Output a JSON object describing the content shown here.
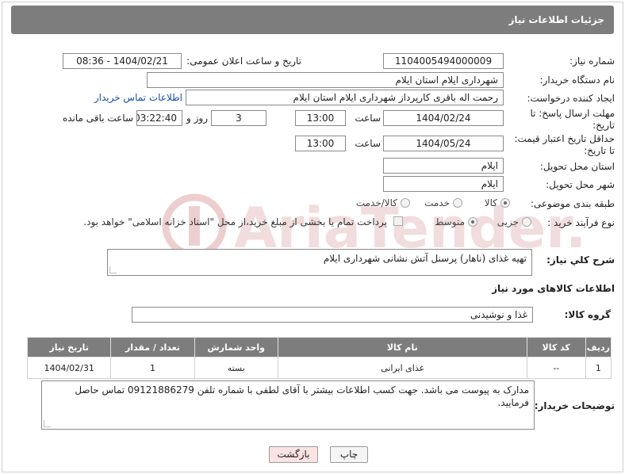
{
  "header": {
    "title": "جزئیات اطلاعات نیاز"
  },
  "form": {
    "need_number_label": "شماره نیاز:",
    "need_number": "1104005494000009",
    "announce_label": "تاریخ و ساعت اعلان عمومی:",
    "announce_value": "1404/02/21 - 08:36",
    "buyer_org_label": "نام دستگاه خریدار:",
    "buyer_org": "شهرداری ایلام استان ایلام",
    "creator_label": "ایجاد کننده درخواست:",
    "creator": "رحمت اله باقری کارپرداز شهرداری ایلام استان ایلام",
    "contact_link": "اطلاعات تماس خریدار",
    "deadline_label_1": "مهلت ارسال پاسخ: تا",
    "deadline_label_2": "تاریخ:",
    "deadline_date": "1404/02/24",
    "time_label": "ساعت",
    "deadline_time": "13:00",
    "days_value": "3",
    "days_label": "روز و",
    "remaining_time": "03:22:40",
    "remaining_label": "ساعت باقی مانده",
    "validity_label_1": "حداقل تاریخ اعتبار قیمت:",
    "validity_label_2": "تا تاریخ:",
    "validity_date": "1404/05/24",
    "validity_time": "13:00",
    "province_label": "استان محل تحویل:",
    "province": "ایلام",
    "city_label": "شهر محل تحویل:",
    "city": "ایلام",
    "category_label": "طبقه بندی موضوعی:",
    "category_options": [
      "کالا",
      "خدمت",
      "کالا/خدمت"
    ],
    "purchase_type_label": "نوع فرآیند خرید :",
    "purchase_options": [
      "جزیی",
      "متوسط"
    ],
    "payment_note": "پرداخت تمام یا بخشی از مبلغ خرید،از محل \"اسناد خزانه اسلامی\" خواهد بود.",
    "description_label": "شرح کلي نياز:",
    "description": "تهیه غذای (ناهار) پرسنل آتش نشانی شهرداری ایلام"
  },
  "goods": {
    "section_title": "اطلاعات کالاهای مورد نیاز",
    "group_label": "گروه کالا:",
    "group_value": "غذا و نوشیدنی",
    "columns": [
      "ردیف",
      "کد کالا",
      "نام کالا",
      "واحد شمارش",
      "تعداد / مقدار",
      "تاریخ نیاز"
    ],
    "rows": [
      [
        "1",
        "--",
        "غذای ایرانی",
        "بسته",
        "1",
        "1404/02/31"
      ]
    ]
  },
  "buyer_notes": {
    "label": "توضیحات خریدار:",
    "text": "مدارک به پیوست می باشد. جهت کسب اطلاعات بیشتر با آقای لطفی با شماره تلفن 09121886279 تماس حاصل فرمایید."
  },
  "actions": {
    "print": "چاپ",
    "back": "بازگشت"
  },
  "colors": {
    "header_bg": "#7d7d7d",
    "link": "#1a4fa3",
    "back_btn_bg": "#fbe3e3",
    "watermark": "#e9c9c9"
  }
}
